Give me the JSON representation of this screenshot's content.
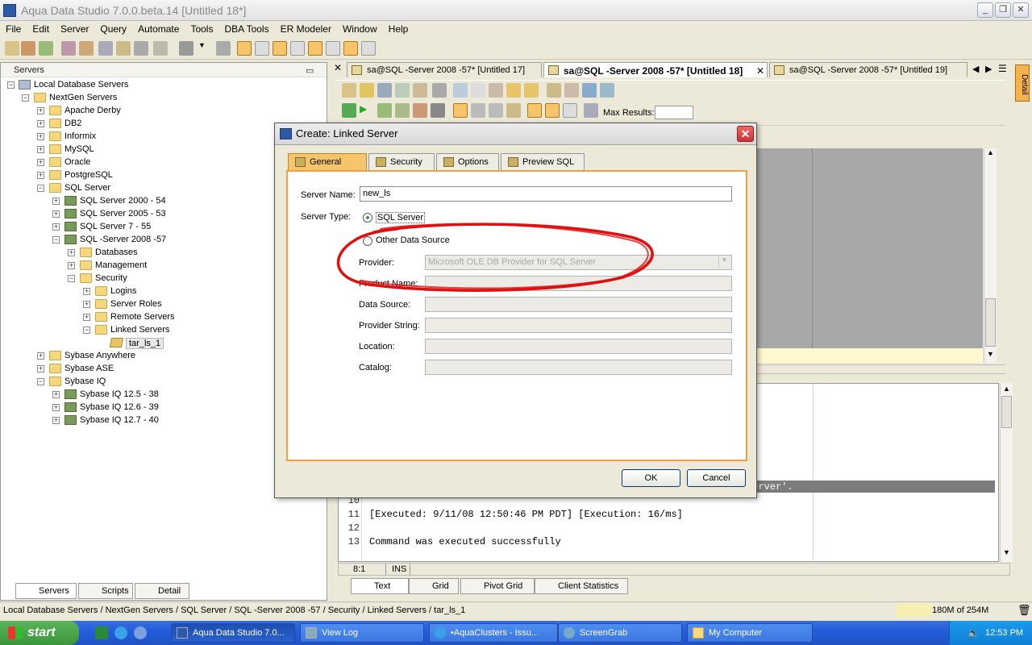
{
  "window": {
    "title": "Aqua Data Studio 7.0.0.beta.14 [Untitled 18*]"
  },
  "menu": [
    "File",
    "Edit",
    "Server",
    "Query",
    "Automate",
    "Tools",
    "DBA Tools",
    "ER Modeler",
    "Window",
    "Help"
  ],
  "servers_panel": {
    "title": "Servers",
    "tree": [
      {
        "label": "Local Database Servers",
        "level": 0,
        "icon": "computer-icon"
      },
      {
        "label": "NextGen Servers",
        "level": 1,
        "icon": "folder-icon"
      },
      {
        "label": "Apache Derby",
        "level": 2,
        "icon": "folder-icon"
      },
      {
        "label": "DB2",
        "level": 2,
        "icon": "folder-icon"
      },
      {
        "label": "Informix",
        "level": 2,
        "icon": "folder-icon"
      },
      {
        "label": "MySQL",
        "level": 2,
        "icon": "folder-icon"
      },
      {
        "label": "Oracle",
        "level": 2,
        "icon": "folder-icon"
      },
      {
        "label": "PostgreSQL",
        "level": 2,
        "icon": "folder-icon"
      },
      {
        "label": "SQL Server",
        "level": 2,
        "icon": "folder-icon"
      },
      {
        "label": "SQL Server 2000 - 54",
        "level": 3,
        "icon": "db-server-icon"
      },
      {
        "label": "SQL Server 2005 - 53",
        "level": 3,
        "icon": "db-server-icon"
      },
      {
        "label": "SQL Server 7 - 55",
        "level": 3,
        "icon": "db-server-icon"
      },
      {
        "label": "SQL -Server 2008 -57",
        "level": 3,
        "icon": "db-server-icon"
      },
      {
        "label": "Databases",
        "level": 4,
        "icon": "folder-icon"
      },
      {
        "label": "Management",
        "level": 4,
        "icon": "folder-icon"
      },
      {
        "label": "Security",
        "level": 4,
        "icon": "folder-icon"
      },
      {
        "label": "Logins",
        "level": 5,
        "icon": "folder-icon"
      },
      {
        "label": "Server Roles",
        "level": 5,
        "icon": "folder-icon"
      },
      {
        "label": "Remote Servers",
        "level": 5,
        "icon": "folder-icon"
      },
      {
        "label": "Linked Servers",
        "level": 5,
        "icon": "folder-icon"
      },
      {
        "label": "tar_ls_1",
        "level": 6,
        "icon": "linked-server-icon"
      },
      {
        "label": "Sybase Anywhere",
        "level": 2,
        "icon": "folder-icon"
      },
      {
        "label": "Sybase ASE",
        "level": 2,
        "icon": "folder-icon"
      },
      {
        "label": "Sybase IQ",
        "level": 2,
        "icon": "folder-icon"
      },
      {
        "label": "Sybase IQ 12.5 - 38",
        "level": 3,
        "icon": "db-server-icon"
      },
      {
        "label": "Sybase IQ 12.6 - 39",
        "level": 3,
        "icon": "db-server-icon"
      },
      {
        "label": "Sybase IQ 12.7 - 40",
        "level": 3,
        "icon": "db-server-icon"
      }
    ],
    "bottom_tabs": [
      "Servers",
      "Scripts",
      "Detail"
    ]
  },
  "doc_tabs": [
    "sa@SQL -Server 2008 -57* [Untitled 17]",
    "sa@SQL -Server 2008 -57* [Untitled 18]",
    "sa@SQL -Server 2008 -57* [Untitled 19]"
  ],
  "query_toolbar": {
    "max_results_label": "Max Results:"
  },
  "results": {
    "lines": [
      {
        "num": "9",
        "text": "You cannot specify a provider or any properties for product 'SQL Server'."
      },
      {
        "num": "10",
        "text": ""
      },
      {
        "num": "11",
        "text": "[Executed: 9/11/08 12:50:46 PM PDT] [Execution: 16/ms]"
      },
      {
        "num": "12",
        "text": ""
      },
      {
        "num": "13",
        "text": "Command was executed successfully"
      }
    ],
    "cursor": "8:1",
    "mode": "INS",
    "tabs": [
      "Text",
      "Grid",
      "Pivot Grid",
      "Client Statistics"
    ]
  },
  "detail_tab": "Detail",
  "status": {
    "path": "Local Database Servers / NextGen Servers / SQL Server / SQL -Server 2008 -57 / Security / Linked Servers / tar_ls_1",
    "memory": "180M of 254M"
  },
  "dialog": {
    "title": "Create: Linked Server",
    "tabs": [
      "General",
      "Security",
      "Options",
      "Preview SQL"
    ],
    "server_name_label": "Server Name:",
    "server_name_value": "new_ls",
    "server_type_label": "Server Type:",
    "radio_sql_server": "SQL Server",
    "radio_other": "Other Data Source",
    "provider_label": "Provider:",
    "provider_value": "Microsoft OLE DB Provider for SQL Server",
    "product_name_label": "Product Name:",
    "data_source_label": "Data Source:",
    "provider_string_label": "Provider String:",
    "location_label": "Location:",
    "catalog_label": "Catalog:",
    "ok": "OK",
    "cancel": "Cancel"
  },
  "taskbar": {
    "start": "start",
    "items": [
      "Aqua Data Studio 7.0...",
      "View Log",
      "•AquaClusters - Issu...",
      "ScreenGrab",
      "My Computer"
    ],
    "clock": "12:53 PM"
  }
}
